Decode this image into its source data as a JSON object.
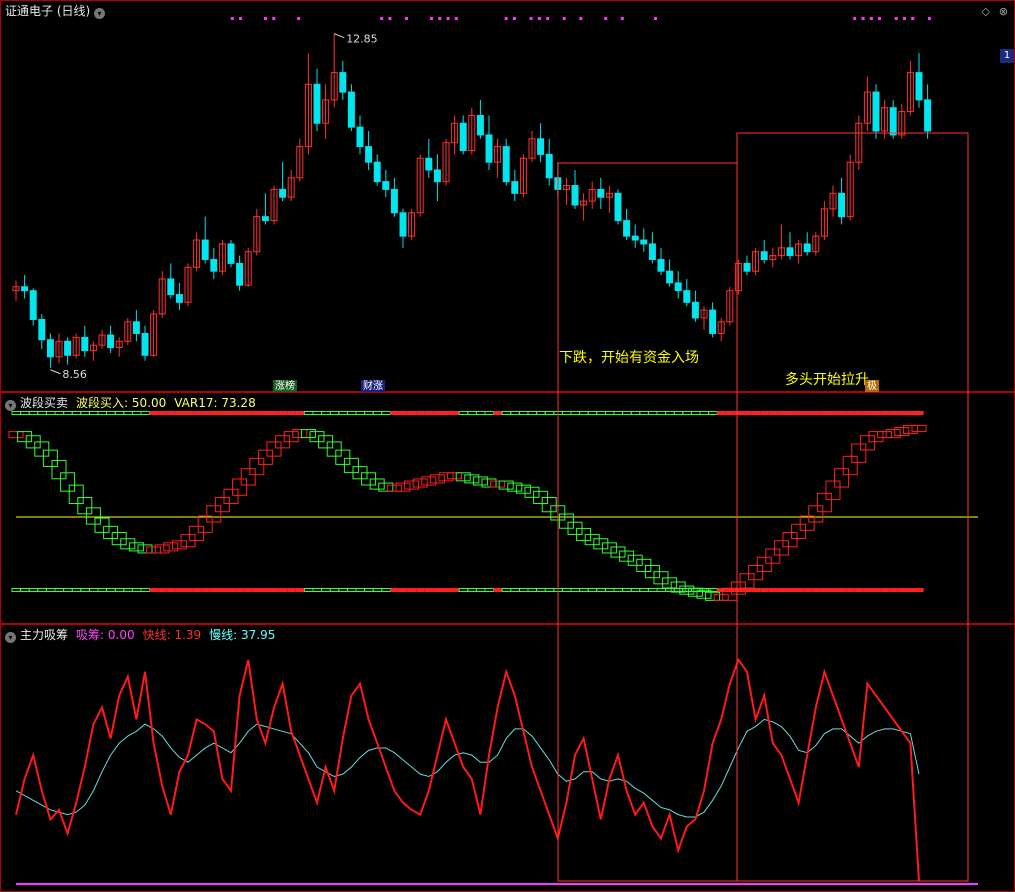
{
  "header1": {
    "stock": "证通电子",
    "period": "(日线)"
  },
  "header2": {
    "title": "波段买卖",
    "buy_label": "波段买入: 50.00",
    "var_label": "VAR17: 73.28"
  },
  "header3": {
    "title": "主力吸筹",
    "xichou_label": "吸筹: 0.00",
    "fast_label": "快线: 1.39",
    "slow_label": "慢线: 37.95"
  },
  "price_high_label": "12.85",
  "price_low_label": "8.56",
  "annotation_down": "下跌，开始有资金入场",
  "annotation_up": "多头开始拉升",
  "badges": {
    "b1": "涨榜",
    "b2": "财涨",
    "b3": "极"
  },
  "right_tag": "1",
  "colors": {
    "up": "#ff3030",
    "down": "#00e5ee",
    "wave_up": "#ff2020",
    "wave_down": "#33ff33",
    "slow": "#66dddd",
    "fast": "#ff1a1a",
    "xichou": "#ff33ff",
    "mid": "#ffff33"
  },
  "chart_data": [
    {
      "type": "candlestick",
      "title": "证通电子 (日线)",
      "annotations": [
        "12.85",
        "8.56"
      ],
      "ohlc": [
        [
          9.55,
          9.68,
          9.42,
          9.6
        ],
        [
          9.6,
          9.75,
          9.45,
          9.55
        ],
        [
          9.55,
          9.58,
          9.1,
          9.18
        ],
        [
          9.18,
          9.25,
          8.8,
          8.92
        ],
        [
          8.92,
          9.0,
          8.56,
          8.7
        ],
        [
          8.7,
          9.0,
          8.62,
          8.9
        ],
        [
          8.9,
          8.95,
          8.6,
          8.72
        ],
        [
          8.72,
          9.0,
          8.68,
          8.95
        ],
        [
          8.95,
          9.1,
          8.7,
          8.78
        ],
        [
          8.78,
          8.9,
          8.65,
          8.85
        ],
        [
          8.85,
          9.05,
          8.8,
          8.98
        ],
        [
          8.98,
          9.1,
          8.75,
          8.82
        ],
        [
          8.82,
          8.95,
          8.7,
          8.9
        ],
        [
          8.9,
          9.2,
          8.85,
          9.15
        ],
        [
          9.15,
          9.3,
          8.9,
          9.0
        ],
        [
          9.0,
          9.1,
          8.65,
          8.72
        ],
        [
          8.72,
          9.3,
          8.7,
          9.25
        ],
        [
          9.25,
          9.8,
          9.2,
          9.7
        ],
        [
          9.7,
          9.9,
          9.45,
          9.5
        ],
        [
          9.5,
          9.65,
          9.3,
          9.4
        ],
        [
          9.4,
          9.9,
          9.35,
          9.85
        ],
        [
          9.85,
          10.3,
          9.8,
          10.2
        ],
        [
          10.2,
          10.5,
          9.9,
          9.95
        ],
        [
          9.95,
          10.1,
          9.7,
          9.8
        ],
        [
          9.8,
          10.2,
          9.75,
          10.15
        ],
        [
          10.15,
          10.2,
          9.85,
          9.9
        ],
        [
          9.9,
          10.0,
          9.55,
          9.62
        ],
        [
          9.62,
          10.1,
          9.6,
          10.05
        ],
        [
          10.05,
          10.6,
          10.0,
          10.5
        ],
        [
          10.5,
          10.8,
          10.4,
          10.45
        ],
        [
          10.45,
          10.9,
          10.4,
          10.85
        ],
        [
          10.85,
          11.2,
          10.7,
          10.75
        ],
        [
          10.75,
          11.1,
          10.7,
          11.0
        ],
        [
          11.0,
          11.5,
          10.95,
          11.4
        ],
        [
          11.4,
          12.6,
          11.3,
          12.2
        ],
        [
          12.2,
          12.4,
          11.6,
          11.7
        ],
        [
          11.7,
          12.2,
          11.5,
          12.0
        ],
        [
          12.0,
          12.85,
          11.9,
          12.35
        ],
        [
          12.35,
          12.5,
          12.0,
          12.1
        ],
        [
          12.1,
          12.2,
          11.6,
          11.65
        ],
        [
          11.65,
          11.8,
          11.3,
          11.4
        ],
        [
          11.4,
          11.6,
          11.1,
          11.2
        ],
        [
          11.2,
          11.3,
          10.9,
          10.95
        ],
        [
          10.95,
          11.1,
          10.75,
          10.85
        ],
        [
          10.85,
          11.0,
          10.5,
          10.55
        ],
        [
          10.55,
          10.6,
          10.1,
          10.25
        ],
        [
          10.25,
          10.6,
          10.2,
          10.55
        ],
        [
          10.55,
          11.3,
          10.5,
          11.25
        ],
        [
          11.25,
          11.5,
          11.0,
          11.1
        ],
        [
          11.1,
          11.3,
          10.7,
          10.95
        ],
        [
          10.95,
          11.5,
          10.9,
          11.45
        ],
        [
          11.45,
          11.8,
          11.3,
          11.7
        ],
        [
          11.7,
          11.8,
          11.3,
          11.35
        ],
        [
          11.35,
          11.9,
          11.3,
          11.8
        ],
        [
          11.8,
          12.0,
          11.5,
          11.55
        ],
        [
          11.55,
          11.8,
          11.1,
          11.2
        ],
        [
          11.2,
          11.5,
          11.0,
          11.4
        ],
        [
          11.4,
          11.5,
          10.9,
          10.95
        ],
        [
          10.95,
          11.1,
          10.7,
          10.8
        ],
        [
          10.8,
          11.3,
          10.75,
          11.25
        ],
        [
          11.25,
          11.6,
          11.2,
          11.5
        ],
        [
          11.5,
          11.7,
          11.2,
          11.3
        ],
        [
          11.3,
          11.5,
          10.9,
          11.0
        ],
        [
          11.0,
          11.2,
          10.75,
          10.85
        ],
        [
          10.85,
          11.0,
          10.65,
          10.9
        ],
        [
          10.9,
          11.1,
          10.6,
          10.65
        ],
        [
          10.65,
          10.8,
          10.45,
          10.7
        ],
        [
          10.7,
          10.95,
          10.6,
          10.85
        ],
        [
          10.85,
          11.0,
          10.6,
          10.75
        ],
        [
          10.75,
          10.9,
          10.55,
          10.8
        ],
        [
          10.8,
          10.85,
          10.4,
          10.45
        ],
        [
          10.45,
          10.6,
          10.2,
          10.25
        ],
        [
          10.25,
          10.4,
          10.1,
          10.2
        ],
        [
          10.2,
          10.35,
          10.05,
          10.15
        ],
        [
          10.15,
          10.3,
          9.9,
          9.95
        ],
        [
          9.95,
          10.1,
          9.75,
          9.8
        ],
        [
          9.8,
          9.95,
          9.6,
          9.65
        ],
        [
          9.65,
          9.8,
          9.45,
          9.55
        ],
        [
          9.55,
          9.7,
          9.35,
          9.4
        ],
        [
          9.4,
          9.55,
          9.15,
          9.2
        ],
        [
          9.2,
          9.35,
          9.05,
          9.3
        ],
        [
          9.3,
          9.4,
          8.95,
          9.0
        ],
        [
          9.0,
          9.2,
          8.9,
          9.15
        ],
        [
          9.15,
          9.6,
          9.1,
          9.55
        ],
        [
          9.55,
          9.95,
          9.5,
          9.9
        ],
        [
          9.9,
          10.0,
          9.75,
          9.8
        ],
        [
          9.8,
          10.1,
          9.75,
          10.05
        ],
        [
          10.05,
          10.2,
          9.9,
          9.95
        ],
        [
          9.95,
          10.1,
          9.85,
          10.0
        ],
        [
          10.0,
          10.4,
          9.95,
          10.1
        ],
        [
          10.1,
          10.3,
          9.95,
          10.0
        ],
        [
          10.0,
          10.2,
          9.9,
          10.15
        ],
        [
          10.15,
          10.3,
          10.0,
          10.05
        ],
        [
          10.05,
          10.3,
          10.0,
          10.25
        ],
        [
          10.25,
          10.7,
          10.2,
          10.6
        ],
        [
          10.6,
          10.9,
          10.5,
          10.8
        ],
        [
          10.8,
          11.0,
          10.4,
          10.5
        ],
        [
          10.5,
          11.3,
          10.45,
          11.2
        ],
        [
          11.2,
          11.8,
          11.1,
          11.7
        ],
        [
          11.7,
          12.3,
          11.6,
          12.1
        ],
        [
          12.1,
          12.2,
          11.5,
          11.6
        ],
        [
          11.6,
          12.0,
          11.5,
          11.9
        ],
        [
          11.9,
          12.0,
          11.5,
          11.55
        ],
        [
          11.55,
          11.95,
          11.5,
          11.85
        ],
        [
          11.85,
          12.5,
          11.8,
          12.35
        ],
        [
          12.35,
          12.6,
          11.9,
          12.0
        ],
        [
          12.0,
          12.2,
          11.5,
          11.6
        ]
      ]
    },
    {
      "type": "line",
      "title": "波段买卖",
      "ylim": [
        0,
        100
      ],
      "mid_line": 50,
      "series": [
        {
          "name": "VAR17",
          "values": [
            90,
            88,
            85,
            81,
            76,
            70,
            64,
            58,
            53,
            48,
            44,
            41,
            38,
            36,
            35,
            34,
            34,
            35,
            36,
            37,
            40,
            44,
            49,
            54,
            58,
            62,
            67,
            72,
            77,
            81,
            85,
            88,
            90,
            91,
            90,
            88,
            85,
            81,
            77,
            73,
            70,
            67,
            65,
            64,
            64,
            65,
            66,
            67,
            68,
            69,
            70,
            70,
            69,
            68,
            67,
            66,
            66,
            65,
            64,
            63,
            61,
            58,
            54,
            50,
            46,
            43,
            40,
            38,
            36,
            34,
            32,
            30,
            28,
            25,
            22,
            19,
            17,
            15,
            14,
            13,
            12,
            11,
            11,
            14,
            17,
            21,
            25,
            29,
            33,
            37,
            41,
            45,
            49,
            54,
            60,
            66,
            72,
            78,
            84,
            88,
            90,
            90,
            91,
            92,
            93,
            93
          ]
        }
      ]
    },
    {
      "type": "line",
      "title": "主力吸筹",
      "ylim": [
        0,
        100
      ],
      "series": [
        {
          "name": "快线",
          "values": [
            30,
            45,
            55,
            40,
            28,
            32,
            22,
            35,
            50,
            68,
            75,
            62,
            80,
            88,
            70,
            90,
            60,
            42,
            30,
            48,
            55,
            70,
            68,
            65,
            45,
            40,
            80,
            95,
            70,
            60,
            75,
            85,
            65,
            55,
            45,
            35,
            50,
            40,
            62,
            80,
            85,
            70,
            60,
            50,
            40,
            35,
            32,
            30,
            40,
            55,
            70,
            60,
            50,
            45,
            30,
            55,
            75,
            90,
            80,
            65,
            50,
            40,
            30,
            20,
            35,
            55,
            62,
            45,
            28,
            45,
            55,
            40,
            30,
            35,
            25,
            20,
            30,
            15,
            25,
            28,
            40,
            60,
            70,
            85,
            95,
            90,
            70,
            80,
            60,
            55,
            45,
            35,
            55,
            75,
            90,
            80,
            70,
            60,
            50,
            85,
            80,
            75,
            70,
            65,
            60,
            2
          ]
        },
        {
          "name": "慢线",
          "values": [
            40,
            38,
            36,
            34,
            32,
            31,
            30,
            31,
            34,
            40,
            48,
            55,
            60,
            63,
            65,
            68,
            66,
            63,
            58,
            54,
            52,
            55,
            58,
            60,
            58,
            56,
            60,
            65,
            68,
            67,
            66,
            65,
            64,
            60,
            56,
            50,
            48,
            46,
            47,
            50,
            54,
            57,
            58,
            58,
            56,
            53,
            50,
            47,
            46,
            48,
            52,
            55,
            56,
            55,
            52,
            52,
            55,
            62,
            66,
            66,
            63,
            58,
            53,
            47,
            44,
            45,
            48,
            48,
            45,
            44,
            45,
            44,
            41,
            39,
            36,
            33,
            32,
            30,
            29,
            29,
            31,
            36,
            42,
            50,
            58,
            65,
            67,
            70,
            69,
            67,
            63,
            57,
            56,
            59,
            64,
            66,
            66,
            63,
            60,
            63,
            65,
            66,
            66,
            65,
            64,
            47
          ]
        },
        {
          "name": "吸筹",
          "values": [
            0,
            0,
            0,
            0,
            0,
            0,
            0,
            0,
            0,
            0,
            0,
            0,
            0,
            0,
            0,
            0,
            0,
            0,
            0,
            0,
            0,
            0,
            0,
            0,
            0,
            0,
            0,
            0,
            0,
            0,
            0,
            0,
            0,
            0,
            0,
            0,
            0,
            0,
            0,
            0,
            0,
            0,
            0,
            0,
            0,
            0,
            0,
            0,
            0,
            0,
            0,
            0,
            0,
            0,
            0,
            0,
            0,
            0,
            0,
            0,
            0,
            0,
            0,
            0,
            0,
            0,
            0,
            0,
            0,
            0,
            0,
            0,
            0,
            0,
            0,
            0,
            0,
            0,
            0,
            0,
            0,
            0,
            0,
            0,
            0,
            0,
            0,
            0,
            0,
            0,
            0,
            0,
            0,
            0,
            0,
            0,
            0,
            0,
            0,
            0,
            0,
            0,
            0,
            0,
            0,
            0
          ]
        }
      ]
    }
  ]
}
